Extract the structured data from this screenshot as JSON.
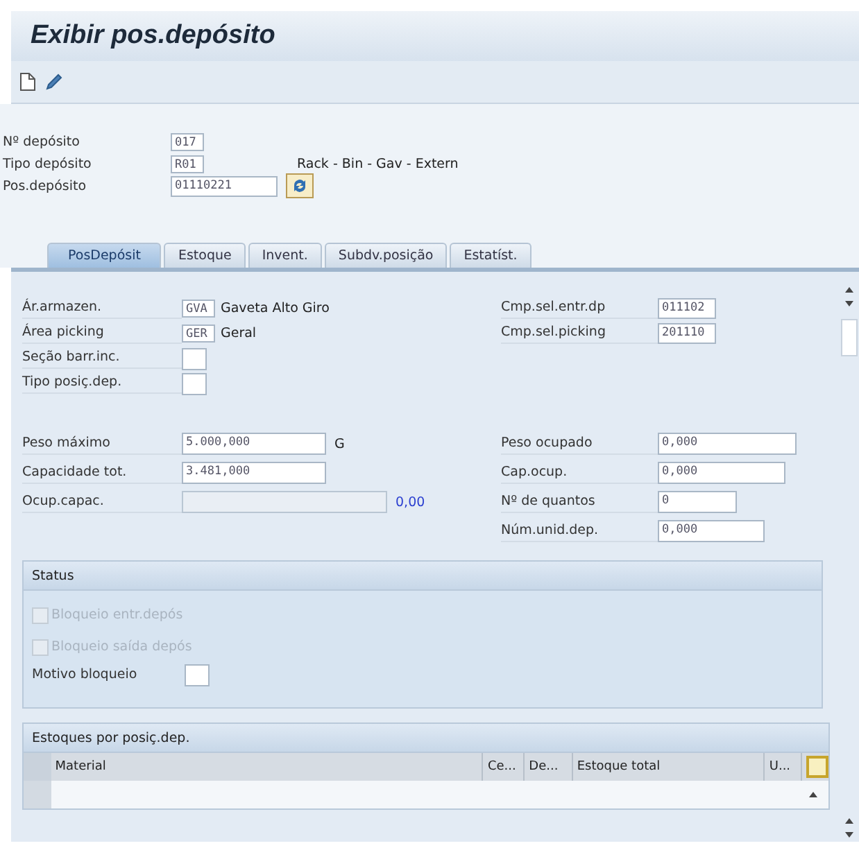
{
  "window": {
    "title": "Exibir pos.depósito"
  },
  "header_fields": [
    {
      "label": "Nº depósito",
      "value": "017"
    },
    {
      "label": "Tipo depósito",
      "value": "R01",
      "description": "Rack - Bin - Gav - Extern"
    },
    {
      "label": "Pos.depósito",
      "value": "01110221"
    }
  ],
  "tabs": [
    {
      "label": "PosDepósit",
      "selected": true
    },
    {
      "label": "Estoque",
      "selected": false
    },
    {
      "label": "Invent.",
      "selected": false
    },
    {
      "label": "Subdv.posição",
      "selected": false
    },
    {
      "label": "Estatíst.",
      "selected": false
    }
  ],
  "fields_left": [
    {
      "label": "Ár.armazen.",
      "value": "GVA",
      "description": "Gaveta Alto Giro"
    },
    {
      "label": "Área picking",
      "value": "GER",
      "description": "Geral"
    },
    {
      "label": "Seção barr.inc."
    },
    {
      "label": "Tipo posiç.dep."
    }
  ],
  "fields_right": [
    {
      "label": "Cmp.sel.entr.dp",
      "value": "011102"
    },
    {
      "label": "Cmp.sel.picking",
      "value": "201110"
    }
  ],
  "capacity_left": [
    {
      "kind": "field",
      "label": "Peso máximo",
      "value": "5.000,000",
      "unit": "G"
    },
    {
      "kind": "field",
      "label": "Capacidade tot.",
      "value": "3.481,000"
    },
    {
      "kind": "meter",
      "label": "Ocup.capac.",
      "level": 0,
      "reading": "0,00"
    }
  ],
  "capacity_right": [
    {
      "label": "Peso ocupado",
      "value": "0,000"
    },
    {
      "label": "Cap.ocup.",
      "value": "0,000"
    },
    {
      "label": "Nº de quantos",
      "value": "0"
    },
    {
      "label": "Núm.unid.dep.",
      "value": "0,000"
    }
  ],
  "status": {
    "title": "Status",
    "checkboxes": [
      {
        "label": "Bloqueio entr.depós",
        "checked": false,
        "disabled": true
      },
      {
        "label": "Bloqueio saída depós",
        "checked": false,
        "disabled": true
      }
    ],
    "block_reason": {
      "label": "Motivo bloqueio"
    }
  },
  "stock_table": {
    "title": "Estoques por posiç.dep.",
    "columns": [
      "Material",
      "Ce...",
      "De...",
      "Estoque total",
      "U..."
    ]
  }
}
